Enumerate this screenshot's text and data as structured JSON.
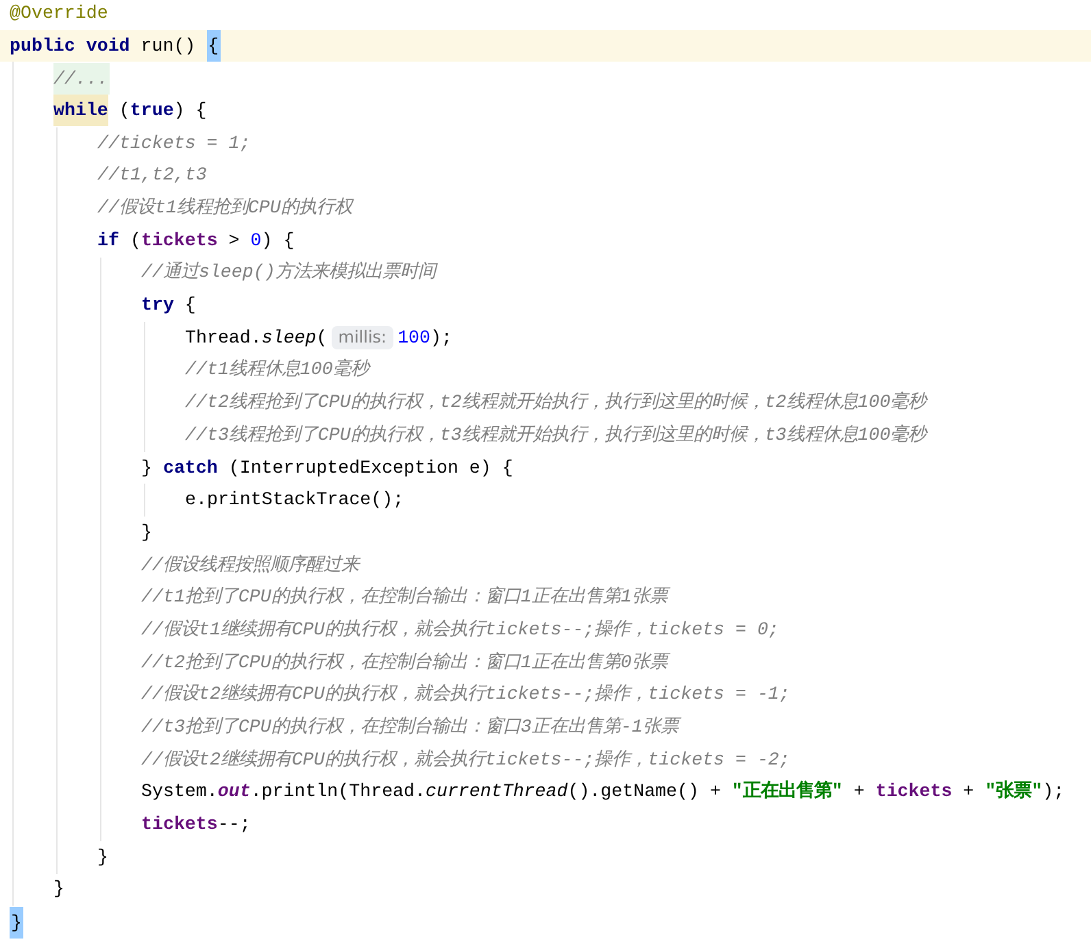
{
  "lines": [
    {
      "tokens": [
        {
          "kind": "annotation",
          "text": "@Override"
        }
      ]
    },
    {
      "current": true,
      "tokens": [
        {
          "kind": "keyword",
          "text": "public "
        },
        {
          "kind": "keyword",
          "text": "void"
        },
        {
          "kind": "plain",
          "text": " run() "
        },
        {
          "kind": "brace_match",
          "text": "{"
        }
      ],
      "children": [
        {
          "tokens": [
            {
              "kind": "folded",
              "text": "//..."
            }
          ]
        },
        {
          "tokens": [
            {
              "kind": "keyword_hl",
              "text": "while"
            },
            {
              "kind": "plain",
              "text": " ("
            },
            {
              "kind": "keyword",
              "text": "true"
            },
            {
              "kind": "plain",
              "text": ") {"
            }
          ],
          "children": [
            {
              "tokens": [
                {
                  "kind": "comment",
                  "text": "//tickets = 1;"
                }
              ]
            },
            {
              "tokens": [
                {
                  "kind": "comment",
                  "text": "//t1,t2,t3"
                }
              ]
            },
            {
              "tokens": [
                {
                  "kind": "comment",
                  "text": "//假设t1线程抢到CPU的执行权"
                }
              ]
            },
            {
              "tokens": [
                {
                  "kind": "keyword",
                  "text": "if"
                },
                {
                  "kind": "plain",
                  "text": " ("
                },
                {
                  "kind": "field",
                  "text": "tickets"
                },
                {
                  "kind": "plain",
                  "text": " > "
                },
                {
                  "kind": "number",
                  "text": "0"
                },
                {
                  "kind": "plain",
                  "text": ") {"
                }
              ],
              "children": [
                {
                  "tokens": [
                    {
                      "kind": "comment",
                      "text": "//通过sleep()方法来模拟出票时间"
                    }
                  ]
                },
                {
                  "tokens": [
                    {
                      "kind": "keyword",
                      "text": "try"
                    },
                    {
                      "kind": "plain",
                      "text": " {"
                    }
                  ],
                  "children": [
                    {
                      "tokens": [
                        {
                          "kind": "plain",
                          "text": "Thread."
                        },
                        {
                          "kind": "static",
                          "text": "sleep"
                        },
                        {
                          "kind": "plain",
                          "text": "("
                        },
                        {
                          "kind": "hint",
                          "text": "millis:"
                        },
                        {
                          "kind": "number",
                          "text": "100"
                        },
                        {
                          "kind": "plain",
                          "text": ");"
                        }
                      ]
                    },
                    {
                      "tokens": [
                        {
                          "kind": "comment",
                          "text": "//t1线程休息100毫秒"
                        }
                      ]
                    },
                    {
                      "tokens": [
                        {
                          "kind": "comment",
                          "text": "//t2线程抢到了CPU的执行权，t2线程就开始执行，执行到这里的时候，t2线程休息100毫秒"
                        }
                      ]
                    },
                    {
                      "tokens": [
                        {
                          "kind": "comment",
                          "text": "//t3线程抢到了CPU的执行权，t3线程就开始执行，执行到这里的时候，t3线程休息100毫秒"
                        }
                      ]
                    }
                  ]
                },
                {
                  "tokens": [
                    {
                      "kind": "plain",
                      "text": "} "
                    },
                    {
                      "kind": "keyword",
                      "text": "catch"
                    },
                    {
                      "kind": "plain",
                      "text": " (InterruptedException e) {"
                    }
                  ],
                  "children": [
                    {
                      "tokens": [
                        {
                          "kind": "plain",
                          "text": "e.printStackTrace();"
                        }
                      ]
                    }
                  ]
                },
                {
                  "tokens": [
                    {
                      "kind": "plain",
                      "text": "}"
                    }
                  ]
                },
                {
                  "tokens": [
                    {
                      "kind": "comment",
                      "text": "//假设线程按照顺序醒过来"
                    }
                  ]
                },
                {
                  "tokens": [
                    {
                      "kind": "comment",
                      "text": "//t1抢到了CPU的执行权，在控制台输出：窗口1正在出售第1张票"
                    }
                  ]
                },
                {
                  "tokens": [
                    {
                      "kind": "comment",
                      "text": "//假设t1继续拥有CPU的执行权，就会执行tickets--;操作，tickets = 0;"
                    }
                  ]
                },
                {
                  "tokens": [
                    {
                      "kind": "comment",
                      "text": "//t2抢到了CPU的执行权，在控制台输出：窗口1正在出售第0张票"
                    }
                  ]
                },
                {
                  "tokens": [
                    {
                      "kind": "comment",
                      "text": "//假设t2继续拥有CPU的执行权，就会执行tickets--;操作，tickets = -1;"
                    }
                  ]
                },
                {
                  "tokens": [
                    {
                      "kind": "comment",
                      "text": "//t3抢到了CPU的执行权，在控制台输出：窗口3正在出售第-1张票"
                    }
                  ]
                },
                {
                  "tokens": [
                    {
                      "kind": "comment",
                      "text": "//假设t2继续拥有CPU的执行权，就会执行tickets--;操作，tickets = -2;"
                    }
                  ]
                },
                {
                  "tokens": [
                    {
                      "kind": "plain",
                      "text": "System."
                    },
                    {
                      "kind": "static_field",
                      "text": "out"
                    },
                    {
                      "kind": "plain",
                      "text": ".println(Thread."
                    },
                    {
                      "kind": "static",
                      "text": "currentThread"
                    },
                    {
                      "kind": "plain",
                      "text": "().getName() + "
                    },
                    {
                      "kind": "string",
                      "text": "\"正在出售第\""
                    },
                    {
                      "kind": "plain",
                      "text": " + "
                    },
                    {
                      "kind": "field",
                      "text": "tickets"
                    },
                    {
                      "kind": "plain",
                      "text": " + "
                    },
                    {
                      "kind": "string",
                      "text": "\"张票\""
                    },
                    {
                      "kind": "plain",
                      "text": ");"
                    }
                  ]
                },
                {
                  "tokens": [
                    {
                      "kind": "field",
                      "text": "tickets"
                    },
                    {
                      "kind": "plain",
                      "text": "--;"
                    }
                  ]
                }
              ]
            },
            {
              "tokens": [
                {
                  "kind": "plain",
                  "text": "}"
                }
              ]
            }
          ]
        },
        {
          "tokens": [
            {
              "kind": "plain",
              "text": "}"
            }
          ]
        }
      ]
    },
    {
      "tokens": [
        {
          "kind": "brace_match",
          "text": "}"
        }
      ]
    }
  ]
}
